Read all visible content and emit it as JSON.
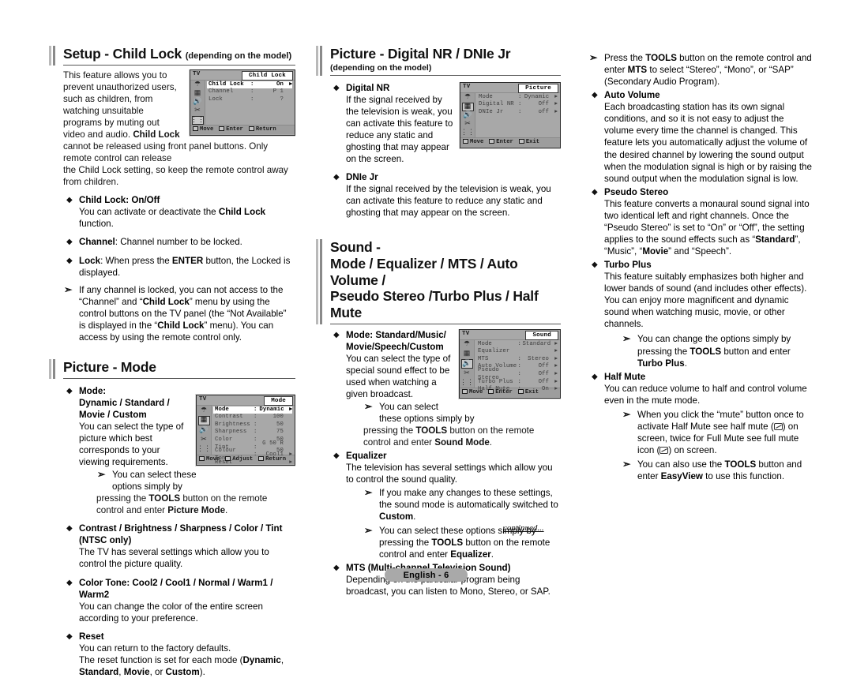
{
  "document": {
    "page_label": "English - 6",
    "continued_label": "continued..."
  },
  "left_column": {
    "section1": {
      "title": "Setup - Child Lock",
      "title_suffix": "(depending on the model)",
      "intro": "This feature allows you to prevent unauthorized users, such as children, from watching unsuitable programs by muting out video and audio. Child Lock cannot be released using front panel buttons. Only remote control can release",
      "intro_tail": "the Child Lock setting, so keep the remote control away from children.",
      "bullets": [
        {
          "glyph": "◆",
          "title": "Child Lock: On/Off",
          "body": "You can activate or deactivate the Child Lock function."
        },
        {
          "glyph": "◆",
          "title": "Channel",
          "body": ": Channel number to be locked."
        },
        {
          "glyph": "◆",
          "title": "Lock",
          "body": ": When press the ENTER button, the Locked is displayed."
        }
      ],
      "note": "If any channel is locked, you can not access to the “Channel” and “Child Lock” menu by using the control buttons on the TV panel (the “Not Available” is displayed in the “Child Lock” menu). You can access by using the remote control only.",
      "osd": {
        "tv_label": "TV",
        "title": "Child Lock",
        "rows": [
          {
            "label": "Child Lock",
            "sep": ":",
            "value": "On",
            "arrow": "▸",
            "highlight": true
          },
          {
            "label": "Channel",
            "sep": ":",
            "value": "P 1",
            "arrow": "",
            "highlight": false
          },
          {
            "label": "Lock",
            "sep": ":",
            "value": "?",
            "arrow": "",
            "highlight": false
          }
        ],
        "footer": [
          "Move",
          "Enter",
          "Return"
        ],
        "selected_icon_index": 5
      }
    },
    "section2": {
      "title": "Picture - Mode",
      "bullets": [
        {
          "glyph": "◆",
          "title": "Mode:",
          "title2": "Dynamic / Standard / Movie / Custom",
          "body": "You can select the type of picture which best corresponds to your viewing requirements.",
          "note": "You can select these options simply by",
          "note_tail": "pressing the TOOLS button on the remote control and enter Picture Mode."
        },
        {
          "glyph": "◆",
          "title": "Contrast / Brightness / Sharpness / Color / Tint (NTSC only)",
          "body": "The TV has several settings which allow you to control the picture quality."
        },
        {
          "glyph": "◆",
          "title": "Color Tone: Cool2 / Cool1 / Normal / Warm1 / Warm2",
          "body": "You can change the color of the entire screen according to your preference."
        },
        {
          "glyph": "◆",
          "title": "Reset",
          "body": "You can return to the factory defaults.",
          "body2": "The reset function is set for each mode (Dynamic, Standard, Movie, or Custom)."
        }
      ],
      "osd": {
        "tv_label": "TV",
        "title": "Mode",
        "rows": [
          {
            "label": "Mode",
            "sep": ":",
            "value": "Dynamic",
            "arrow": "▸",
            "highlight": true
          },
          {
            "label": "Contrast",
            "sep": ":",
            "value": "100",
            "arrow": "",
            "highlight": false
          },
          {
            "label": "Brightness",
            "sep": ":",
            "value": "50",
            "arrow": "",
            "highlight": false
          },
          {
            "label": "Sharpness",
            "sep": ":",
            "value": "75",
            "arrow": "",
            "highlight": false
          },
          {
            "label": "Color",
            "sep": ":",
            "value": "50",
            "arrow": "",
            "highlight": false
          },
          {
            "label": "Tint",
            "sep": ":",
            "value": "G 50   R 50",
            "arrow": "",
            "highlight": false
          },
          {
            "label": "Colour Tone",
            "sep": ":",
            "value": "Cool1",
            "arrow": "▸",
            "highlight": false
          },
          {
            "label": "Reset",
            "sep": "",
            "value": "",
            "arrow": "▸",
            "highlight": false
          }
        ],
        "footer": [
          "Move",
          "Adjust",
          "Return"
        ],
        "selected_icon_index": 1
      }
    }
  },
  "mid_column": {
    "section1": {
      "title": "Picture - Digital NR / DNIe Jr",
      "subtitle": "(depending on the model)",
      "bullets": [
        {
          "glyph": "◆",
          "title": "Digital NR",
          "body": "If the signal received by the television is weak, you can activate this feature to reduce any static and ghosting that may appear on the screen."
        },
        {
          "glyph": "◆",
          "title": "DNIe Jr",
          "body": "If the signal received by the television is weak, you can activate this feature to reduce any static and ghosting that may appear on the screen."
        }
      ],
      "osd": {
        "tv_label": "TV",
        "title": "Picture",
        "rows": [
          {
            "label": "Mode",
            "sep": ":",
            "value": "Dynamic",
            "arrow": "▸",
            "highlight": false
          },
          {
            "label": "Digital NR",
            "sep": ":",
            "value": "Off",
            "arrow": "▸",
            "highlight": false
          },
          {
            "label": "DNIe Jr",
            "sep": ":",
            "value": "off",
            "arrow": "▸",
            "highlight": false
          }
        ],
        "footer": [
          "Move",
          "Enter",
          "Exit"
        ],
        "selected_icon_index": 1
      }
    },
    "section2": {
      "title_line1": "Sound -",
      "title_line2": "Mode / Equalizer / MTS / Auto Volume /",
      "title_line3": "Pseudo Stereo /Turbo Plus / Half Mute",
      "bullets": [
        {
          "glyph": "◆",
          "title": "Mode: Standard/Music/ Movie/Speech/Custom",
          "body": "You can select the type of special sound effect to be used when watching a given broadcast.",
          "note": "You can select these options simply by",
          "note_tail": "pressing the TOOLS button on the remote control and enter Sound Mode."
        },
        {
          "glyph": "◆",
          "title": "Equalizer",
          "body": "The television has several settings which allow you to control the sound quality.",
          "notes": [
            "If you make any changes to these settings, the sound mode is automatically switched to Custom.",
            "You can select these options simply by pressing the TOOLS button on the remote control and enter Equalizer."
          ]
        },
        {
          "glyph": "◆",
          "title": "MTS (Multi-channel Television Sound)",
          "body": "Depending on the particular program being broadcast, you can listen to Mono, Stereo, or SAP."
        }
      ],
      "osd": {
        "tv_label": "TV",
        "title": "Sound",
        "rows": [
          {
            "label": "Mode",
            "sep": ":",
            "value": "Standard",
            "arrow": "▸",
            "highlight": false
          },
          {
            "label": "Equalizer",
            "sep": "",
            "value": "",
            "arrow": "▸",
            "highlight": false
          },
          {
            "label": "MTS",
            "sep": ":",
            "value": "Stereo",
            "arrow": "▸",
            "highlight": false
          },
          {
            "label": "Auto Volume",
            "sep": ":",
            "value": "Off",
            "arrow": "▸",
            "highlight": false
          },
          {
            "label": "Pseudo Stereo",
            "sep": ":",
            "value": "Off",
            "arrow": "▸",
            "highlight": false
          },
          {
            "label": "Turbo Plus",
            "sep": ":",
            "value": "Off",
            "arrow": "▸",
            "highlight": false
          },
          {
            "label": "Half Mute",
            "sep": ":",
            "value": "On",
            "arrow": "▸",
            "highlight": false
          }
        ],
        "footer": [
          "Move",
          "Enter",
          "Exit"
        ],
        "selected_icon_index": 2
      }
    }
  },
  "right_column": {
    "top_note": "Press the TOOLS button on the remote control and enter MTS to select “Stereo”, “Mono”, or “SAP” (Secondary Audio Program).",
    "bullets": [
      {
        "glyph": "◆",
        "title": "Auto Volume",
        "body": "Each broadcasting station has its own signal conditions, and so it is not easy to adjust the volume every time the channel is changed. This feature lets you automatically adjust the volume of the desired channel by lowering the sound output when the modulation signal is high or by raising the sound output when the modulation signal is low."
      },
      {
        "glyph": "◆",
        "title": "Pseudo Stereo",
        "body": "This feature converts a monaural sound signal into two identical left and right channels. Once the “Pseudo Stereo” is set to “On” or “Off”, the setting applies to the sound effects such as “Standard”, “Music”, “Movie” and “Speech”."
      },
      {
        "glyph": "◆",
        "title": "Turbo Plus",
        "body": "This feature suitably emphasizes both higher and lower bands of sound (and includes other effects). You can enjoy more magnificent and dynamic sound when watching music, movie, or other channels.",
        "note": "You can change the options simply by pressing the TOOLS button and enter Turbo Plus."
      },
      {
        "glyph": "◆",
        "title": "Half Mute",
        "body": "You can reduce volume to half and control volume even in the mute mode.",
        "note_a_1": "When you click the “mute” button once to activate Half Mute see half mute (",
        "note_a_2": ") on screen, twice for Full Mute see full mute icon (",
        "note_a_3": ") on screen.",
        "note_b": "You can also use the TOOLS button and enter EasyView to use this function."
      }
    ]
  }
}
